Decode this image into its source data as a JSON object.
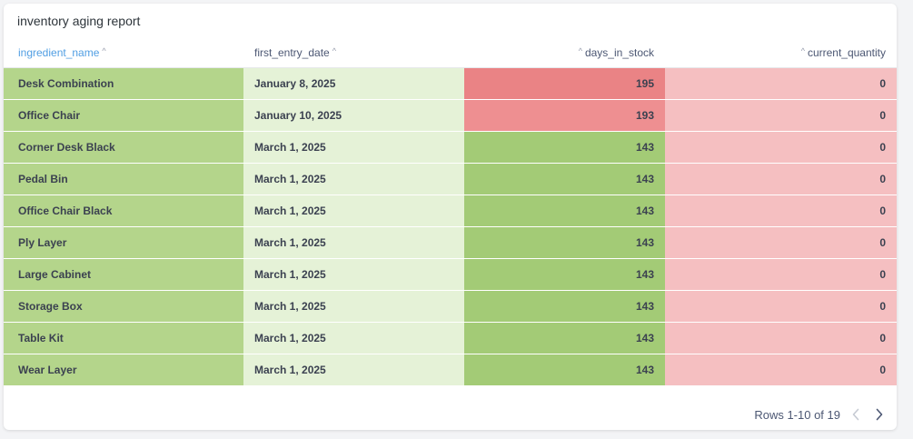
{
  "card": {
    "title": "inventory aging report"
  },
  "table": {
    "columns": [
      {
        "label": "ingredient_name",
        "sort_icon": "chevron-up-icon",
        "active": true
      },
      {
        "label": "first_entry_date",
        "sort_icon": "chevron-up-icon",
        "active": false
      },
      {
        "label": "days_in_stock",
        "sort_icon": "chevron-up-icon",
        "active": false
      },
      {
        "label": "current_quantity",
        "sort_icon": "chevron-up-icon",
        "active": false
      }
    ],
    "rows": [
      {
        "ingredient_name": "Desk Combination",
        "first_entry_date": "January 8, 2025",
        "days_in_stock": "195",
        "current_quantity": "0"
      },
      {
        "ingredient_name": "Office Chair",
        "first_entry_date": "January 10, 2025",
        "days_in_stock": "193",
        "current_quantity": "0"
      },
      {
        "ingredient_name": "Corner Desk Black",
        "first_entry_date": "March 1, 2025",
        "days_in_stock": "143",
        "current_quantity": "0"
      },
      {
        "ingredient_name": "Pedal Bin",
        "first_entry_date": "March 1, 2025",
        "days_in_stock": "143",
        "current_quantity": "0"
      },
      {
        "ingredient_name": "Office Chair Black",
        "first_entry_date": "March 1, 2025",
        "days_in_stock": "143",
        "current_quantity": "0"
      },
      {
        "ingredient_name": "Ply Layer",
        "first_entry_date": "March 1, 2025",
        "days_in_stock": "143",
        "current_quantity": "0"
      },
      {
        "ingredient_name": "Large Cabinet",
        "first_entry_date": "March 1, 2025",
        "days_in_stock": "143",
        "current_quantity": "0"
      },
      {
        "ingredient_name": "Storage Box",
        "first_entry_date": "March 1, 2025",
        "days_in_stock": "143",
        "current_quantity": "0"
      },
      {
        "ingredient_name": "Table Kit",
        "first_entry_date": "March 1, 2025",
        "days_in_stock": "143",
        "current_quantity": "0"
      },
      {
        "ingredient_name": "Wear Layer",
        "first_entry_date": "March 1, 2025",
        "days_in_stock": "143",
        "current_quantity": "0"
      }
    ]
  },
  "colors": {
    "active_header": "#509ee3",
    "name_col": "#b4d58b",
    "date_col": "#e5f2d7",
    "days_col_normal": "#a3cb76",
    "days_col_high": "#ea8385",
    "quantity_col": "#f5bfc1"
  },
  "footer": {
    "rows_text": "Rows 1-10 of 19",
    "prev_icon": "chevron-left-icon",
    "next_icon": "chevron-right-icon"
  }
}
